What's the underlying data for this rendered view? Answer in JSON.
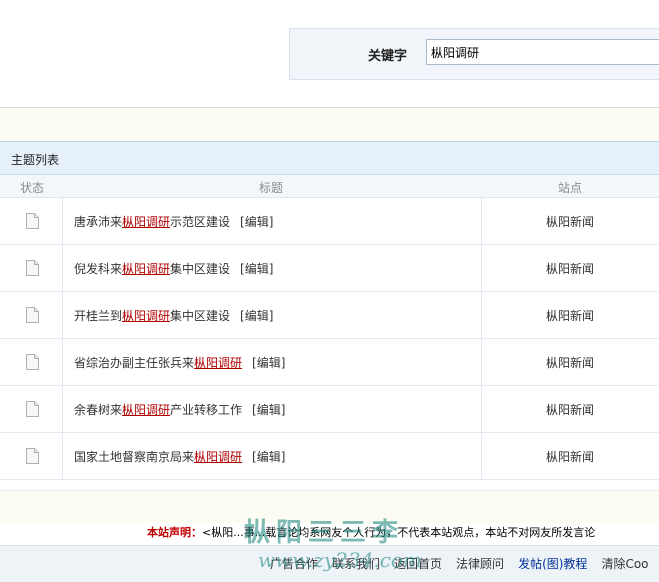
{
  "search": {
    "label": "关键字",
    "value": "枞阳调研"
  },
  "list": {
    "title": "主题列表",
    "columns": {
      "status": "状态",
      "title": "标题",
      "site": "站点"
    },
    "edit_label": "[编辑]",
    "rows": [
      {
        "prefix": "唐承沛来",
        "keyword": "枞阳调研",
        "suffix": "示范区建设",
        "site": "枞阳新闻"
      },
      {
        "prefix": "倪发科来",
        "keyword": "枞阳调研",
        "suffix": "集中区建设",
        "site": "枞阳新闻"
      },
      {
        "prefix": "开桂兰到",
        "keyword": "枞阳调研",
        "suffix": "集中区建设",
        "site": "枞阳新闻"
      },
      {
        "prefix": "省综治办副主任张兵来",
        "keyword": "枞阳调研",
        "suffix": "",
        "site": "枞阳新闻"
      },
      {
        "prefix": "余春树来",
        "keyword": "枞阳调研",
        "suffix": "产业转移工作",
        "site": "枞阳新闻"
      },
      {
        "prefix": "国家土地督察南京局来",
        "keyword": "枞阳调研",
        "suffix": "",
        "site": "枞阳新闻"
      }
    ]
  },
  "notice": {
    "label": "本站声明：",
    "text": "<枞阳...事...载言论均系网友个人行为，不代表本站观点，本站不对网友所发言论"
  },
  "footer": {
    "links": [
      "广告合作",
      "联系我们",
      "返回首页",
      "法律顾问",
      "发帖(图)教程",
      "清除Coo"
    ]
  },
  "watermark": {
    "line1": "枞阳三三李",
    "line2": "www.zy234.com"
  },
  "colors": {
    "keyword": "#b00000",
    "header_bg": "#e6f0f9",
    "notice_label": "#c00000"
  },
  "icons": {
    "row_status": "document-icon"
  }
}
